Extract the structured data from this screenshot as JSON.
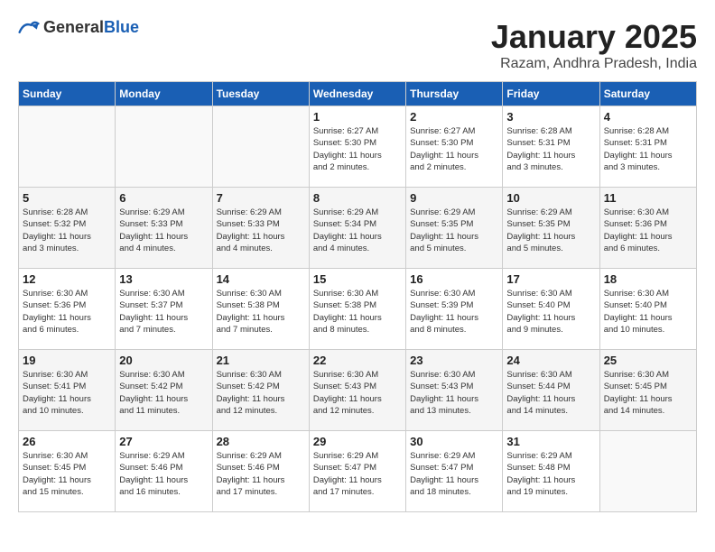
{
  "logo": {
    "general": "General",
    "blue": "Blue"
  },
  "header": {
    "month": "January 2025",
    "location": "Razam, Andhra Pradesh, India"
  },
  "days_of_week": [
    "Sunday",
    "Monday",
    "Tuesday",
    "Wednesday",
    "Thursday",
    "Friday",
    "Saturday"
  ],
  "weeks": [
    [
      {
        "day": "",
        "info": ""
      },
      {
        "day": "",
        "info": ""
      },
      {
        "day": "",
        "info": ""
      },
      {
        "day": "1",
        "info": "Sunrise: 6:27 AM\nSunset: 5:30 PM\nDaylight: 11 hours\nand 2 minutes."
      },
      {
        "day": "2",
        "info": "Sunrise: 6:27 AM\nSunset: 5:30 PM\nDaylight: 11 hours\nand 2 minutes."
      },
      {
        "day": "3",
        "info": "Sunrise: 6:28 AM\nSunset: 5:31 PM\nDaylight: 11 hours\nand 3 minutes."
      },
      {
        "day": "4",
        "info": "Sunrise: 6:28 AM\nSunset: 5:31 PM\nDaylight: 11 hours\nand 3 minutes."
      }
    ],
    [
      {
        "day": "5",
        "info": "Sunrise: 6:28 AM\nSunset: 5:32 PM\nDaylight: 11 hours\nand 3 minutes."
      },
      {
        "day": "6",
        "info": "Sunrise: 6:29 AM\nSunset: 5:33 PM\nDaylight: 11 hours\nand 4 minutes."
      },
      {
        "day": "7",
        "info": "Sunrise: 6:29 AM\nSunset: 5:33 PM\nDaylight: 11 hours\nand 4 minutes."
      },
      {
        "day": "8",
        "info": "Sunrise: 6:29 AM\nSunset: 5:34 PM\nDaylight: 11 hours\nand 4 minutes."
      },
      {
        "day": "9",
        "info": "Sunrise: 6:29 AM\nSunset: 5:35 PM\nDaylight: 11 hours\nand 5 minutes."
      },
      {
        "day": "10",
        "info": "Sunrise: 6:29 AM\nSunset: 5:35 PM\nDaylight: 11 hours\nand 5 minutes."
      },
      {
        "day": "11",
        "info": "Sunrise: 6:30 AM\nSunset: 5:36 PM\nDaylight: 11 hours\nand 6 minutes."
      }
    ],
    [
      {
        "day": "12",
        "info": "Sunrise: 6:30 AM\nSunset: 5:36 PM\nDaylight: 11 hours\nand 6 minutes."
      },
      {
        "day": "13",
        "info": "Sunrise: 6:30 AM\nSunset: 5:37 PM\nDaylight: 11 hours\nand 7 minutes."
      },
      {
        "day": "14",
        "info": "Sunrise: 6:30 AM\nSunset: 5:38 PM\nDaylight: 11 hours\nand 7 minutes."
      },
      {
        "day": "15",
        "info": "Sunrise: 6:30 AM\nSunset: 5:38 PM\nDaylight: 11 hours\nand 8 minutes."
      },
      {
        "day": "16",
        "info": "Sunrise: 6:30 AM\nSunset: 5:39 PM\nDaylight: 11 hours\nand 8 minutes."
      },
      {
        "day": "17",
        "info": "Sunrise: 6:30 AM\nSunset: 5:40 PM\nDaylight: 11 hours\nand 9 minutes."
      },
      {
        "day": "18",
        "info": "Sunrise: 6:30 AM\nSunset: 5:40 PM\nDaylight: 11 hours\nand 10 minutes."
      }
    ],
    [
      {
        "day": "19",
        "info": "Sunrise: 6:30 AM\nSunset: 5:41 PM\nDaylight: 11 hours\nand 10 minutes."
      },
      {
        "day": "20",
        "info": "Sunrise: 6:30 AM\nSunset: 5:42 PM\nDaylight: 11 hours\nand 11 minutes."
      },
      {
        "day": "21",
        "info": "Sunrise: 6:30 AM\nSunset: 5:42 PM\nDaylight: 11 hours\nand 12 minutes."
      },
      {
        "day": "22",
        "info": "Sunrise: 6:30 AM\nSunset: 5:43 PM\nDaylight: 11 hours\nand 12 minutes."
      },
      {
        "day": "23",
        "info": "Sunrise: 6:30 AM\nSunset: 5:43 PM\nDaylight: 11 hours\nand 13 minutes."
      },
      {
        "day": "24",
        "info": "Sunrise: 6:30 AM\nSunset: 5:44 PM\nDaylight: 11 hours\nand 14 minutes."
      },
      {
        "day": "25",
        "info": "Sunrise: 6:30 AM\nSunset: 5:45 PM\nDaylight: 11 hours\nand 14 minutes."
      }
    ],
    [
      {
        "day": "26",
        "info": "Sunrise: 6:30 AM\nSunset: 5:45 PM\nDaylight: 11 hours\nand 15 minutes."
      },
      {
        "day": "27",
        "info": "Sunrise: 6:29 AM\nSunset: 5:46 PM\nDaylight: 11 hours\nand 16 minutes."
      },
      {
        "day": "28",
        "info": "Sunrise: 6:29 AM\nSunset: 5:46 PM\nDaylight: 11 hours\nand 17 minutes."
      },
      {
        "day": "29",
        "info": "Sunrise: 6:29 AM\nSunset: 5:47 PM\nDaylight: 11 hours\nand 17 minutes."
      },
      {
        "day": "30",
        "info": "Sunrise: 6:29 AM\nSunset: 5:47 PM\nDaylight: 11 hours\nand 18 minutes."
      },
      {
        "day": "31",
        "info": "Sunrise: 6:29 AM\nSunset: 5:48 PM\nDaylight: 11 hours\nand 19 minutes."
      },
      {
        "day": "",
        "info": ""
      }
    ]
  ]
}
